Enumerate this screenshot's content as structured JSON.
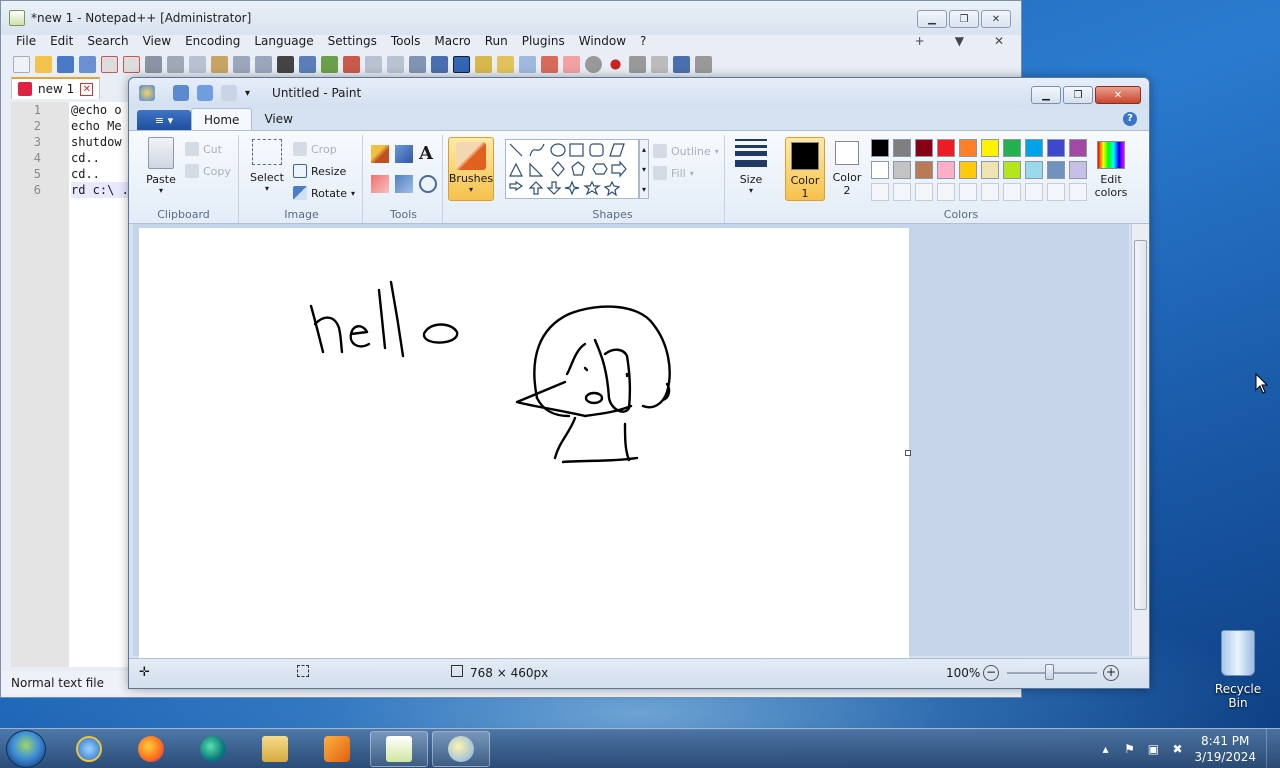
{
  "notepad": {
    "title": "*new 1 - Notepad++ [Administrator]",
    "menu": [
      "File",
      "Edit",
      "Search",
      "View",
      "Encoding",
      "Language",
      "Settings",
      "Tools",
      "Macro",
      "Run",
      "Plugins",
      "Window",
      "?"
    ],
    "menu_right": [
      "+",
      "▼",
      "✕"
    ],
    "tab_label": "new 1",
    "lines": [
      {
        "num": "1",
        "text": "@echo o"
      },
      {
        "num": "2",
        "text": "echo Me"
      },
      {
        "num": "3",
        "text": "shutdow"
      },
      {
        "num": "4",
        "text": "cd.."
      },
      {
        "num": "5",
        "text": "cd.."
      },
      {
        "num": "6",
        "text": "rd c:\\ ."
      }
    ],
    "status": "Normal text file"
  },
  "paint": {
    "title": "Untitled - Paint",
    "tabs": [
      "Home",
      "View"
    ],
    "clipboard": {
      "paste": "Paste",
      "cut": "Cut",
      "copy": "Copy",
      "group": "Clipboard"
    },
    "image": {
      "select": "Select",
      "crop": "Crop",
      "resize": "Resize",
      "rotate": "Rotate",
      "group": "Image"
    },
    "tools": {
      "group": "Tools",
      "text_tool": "A"
    },
    "brushes": "Brushes",
    "shapes": {
      "outline": "Outline",
      "fill": "Fill",
      "group": "Shapes"
    },
    "size": "Size",
    "color1": {
      "line1": "Color",
      "line2": "1"
    },
    "color2": {
      "line1": "Color",
      "line2": "2"
    },
    "colors_group": "Colors",
    "edit_colors": {
      "line1": "Edit",
      "line2": "colors"
    },
    "palette": [
      "#000000",
      "#7f7f7f",
      "#880015",
      "#ed1c24",
      "#ff7f27",
      "#fff200",
      "#22b14c",
      "#00a2e8",
      "#3f48cc",
      "#a349a4",
      "#ffffff",
      "#c3c3c3",
      "#b97a57",
      "#ffaec9",
      "#ffc90e",
      "#efe4b0",
      "#b5e61d",
      "#99d9ea",
      "#7092be",
      "#c8bfe7"
    ],
    "canvas_text": "hello",
    "status": {
      "size": "768 × 460px",
      "zoom": "100%"
    }
  },
  "desktop": {
    "recycle_bin": "Recycle Bin"
  },
  "taskbar": {
    "time": "8:41 PM",
    "date": "3/19/2024"
  }
}
